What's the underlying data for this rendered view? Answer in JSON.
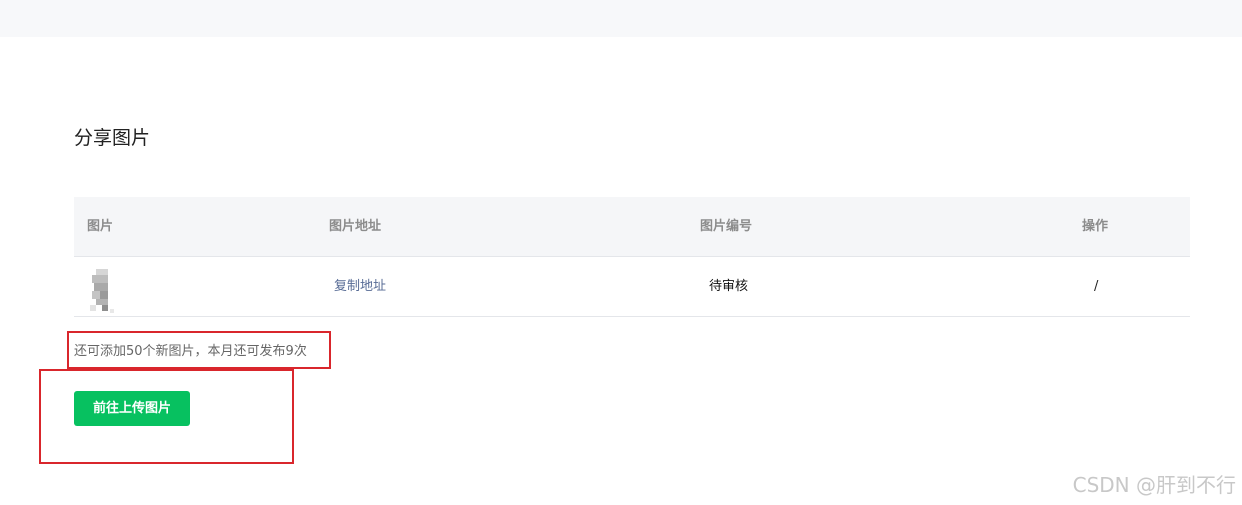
{
  "page": {
    "section_title": "分享图片"
  },
  "table": {
    "headers": {
      "image": "图片",
      "address": "图片地址",
      "number": "图片编号",
      "action": "操作"
    },
    "rows": [
      {
        "address_link": "复制地址",
        "number": "待审核",
        "action": "/"
      }
    ]
  },
  "quota": {
    "text": "还可添加50个新图片，本月还可发布9次"
  },
  "upload": {
    "button_label": "前往上传图片"
  },
  "watermark": {
    "text": "CSDN @肝到不行"
  },
  "colors": {
    "primary_green": "#07c160",
    "link_blue": "#576b95",
    "annotation_red": "#d9262c"
  }
}
